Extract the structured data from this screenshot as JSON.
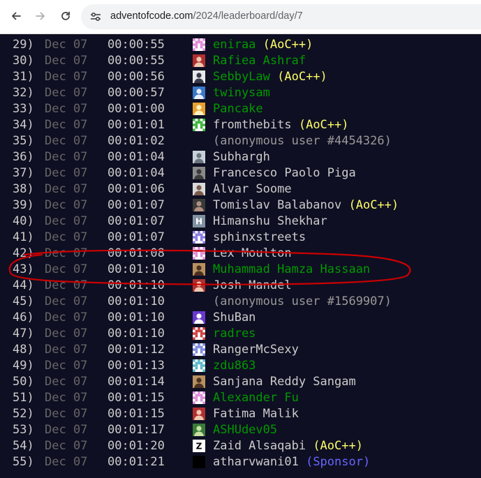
{
  "browser": {
    "url_host": "adventofcode.com",
    "url_path": "/2024/leaderboard/day/7",
    "icons": [
      "back-arrow-icon",
      "forward-arrow-icon",
      "reload-icon",
      "site-settings-icon"
    ]
  },
  "colors": {
    "background": "#0f0f23",
    "text": "#cccccc",
    "date": "#666666",
    "link_green": "#009900",
    "aocpp": "#ffff66",
    "sponsor": "#6666ff",
    "annotation": "#cc0000"
  },
  "leaderboard": {
    "rows": [
      {
        "rank": "29)",
        "date": "Dec 07",
        "time": "00:00:55",
        "name": "eniraa",
        "badge": "(AoC++)",
        "style": "green",
        "avatar": "pink-pixel"
      },
      {
        "rank": "30)",
        "date": "Dec 07",
        "time": "00:00:55",
        "name": "Rafiea Ashraf",
        "badge": "",
        "style": "green",
        "avatar": "photo-red"
      },
      {
        "rank": "31)",
        "date": "Dec 07",
        "time": "00:00:56",
        "name": "SebbyLaw",
        "badge": "(AoC++)",
        "style": "green",
        "avatar": "anime"
      },
      {
        "rank": "32)",
        "date": "Dec 07",
        "time": "00:00:57",
        "name": "twinysam",
        "badge": "",
        "style": "green",
        "avatar": "blue-figure"
      },
      {
        "rank": "33)",
        "date": "Dec 07",
        "time": "00:01:00",
        "name": "Pancake",
        "badge": "",
        "style": "green",
        "avatar": "pancake"
      },
      {
        "rank": "34)",
        "date": "Dec 07",
        "time": "00:01:01",
        "name": "fromthebits",
        "badge": "(AoC++)",
        "style": "normal",
        "avatar": "green-pixel"
      },
      {
        "rank": "35)",
        "date": "Dec 07",
        "time": "00:01:02",
        "name": "(anonymous user #4454326)",
        "badge": "",
        "style": "anon",
        "avatar": "none"
      },
      {
        "rank": "36)",
        "date": "Dec 07",
        "time": "00:01:04",
        "name": "Subhargh",
        "badge": "",
        "style": "normal",
        "avatar": "default-person"
      },
      {
        "rank": "37)",
        "date": "Dec 07",
        "time": "00:01:04",
        "name": "Francesco Paolo Piga",
        "badge": "",
        "style": "normal",
        "avatar": "photo-gray"
      },
      {
        "rank": "38)",
        "date": "Dec 07",
        "time": "00:01:06",
        "name": "Alvar Soome",
        "badge": "",
        "style": "normal",
        "avatar": "photo-light"
      },
      {
        "rank": "39)",
        "date": "Dec 07",
        "time": "00:01:07",
        "name": "Tomislav Balabanov",
        "badge": "(AoC++)",
        "style": "normal",
        "avatar": "photo-dark"
      },
      {
        "rank": "40)",
        "date": "Dec 07",
        "time": "00:01:07",
        "name": "Himanshu Shekhar",
        "badge": "",
        "style": "normal",
        "avatar": "letter-h"
      },
      {
        "rank": "41)",
        "date": "Dec 07",
        "time": "00:01:07",
        "name": "sphinxstreets",
        "badge": "",
        "style": "normal",
        "avatar": "purple-pixel"
      },
      {
        "rank": "42)",
        "date": "Dec 07",
        "time": "00:01:08",
        "name": "Lex Moulton",
        "badge": "",
        "style": "normal",
        "avatar": "pink-pixel"
      },
      {
        "rank": "43)",
        "date": "Dec 07",
        "time": "00:01:10",
        "name": "Muhammad Hamza Hassaan",
        "badge": "",
        "style": "green",
        "avatar": "photo-warm"
      },
      {
        "rank": "44)",
        "date": "Dec 07",
        "time": "00:01:10",
        "name": "Josh Mandel",
        "badge": "",
        "style": "normal",
        "avatar": "photo-red"
      },
      {
        "rank": "45)",
        "date": "Dec 07",
        "time": "00:01:10",
        "name": "(anonymous user #1569907)",
        "badge": "",
        "style": "anon",
        "avatar": "none"
      },
      {
        "rank": "46)",
        "date": "Dec 07",
        "time": "00:01:10",
        "name": "ShuBan",
        "badge": "",
        "style": "normal",
        "avatar": "purple-unicorn"
      },
      {
        "rank": "47)",
        "date": "Dec 07",
        "time": "00:01:10",
        "name": "radres",
        "badge": "",
        "style": "green",
        "avatar": "red-pixel"
      },
      {
        "rank": "48)",
        "date": "Dec 07",
        "time": "00:01:12",
        "name": "RangerMcSexy",
        "badge": "",
        "style": "normal",
        "avatar": "blue-pixel"
      },
      {
        "rank": "49)",
        "date": "Dec 07",
        "time": "00:01:13",
        "name": "zdu863",
        "badge": "",
        "style": "green",
        "avatar": "teal-pixel"
      },
      {
        "rank": "50)",
        "date": "Dec 07",
        "time": "00:01:14",
        "name": "Sanjana Reddy Sangam",
        "badge": "",
        "style": "normal",
        "avatar": "photo-warm"
      },
      {
        "rank": "51)",
        "date": "Dec 07",
        "time": "00:01:15",
        "name": "Alexander Fu",
        "badge": "",
        "style": "green",
        "avatar": "pink-pixel"
      },
      {
        "rank": "52)",
        "date": "Dec 07",
        "time": "00:01:15",
        "name": "Fatima Malik",
        "badge": "",
        "style": "normal",
        "avatar": "photo-red"
      },
      {
        "rank": "53)",
        "date": "Dec 07",
        "time": "00:01:17",
        "name": "ASHUdev05",
        "badge": "",
        "style": "green",
        "avatar": "photo-green"
      },
      {
        "rank": "54)",
        "date": "Dec 07",
        "time": "00:01:20",
        "name": "Zaid Alsaqabi",
        "badge": "(AoC++)",
        "style": "normal",
        "avatar": "letter-z"
      },
      {
        "rank": "55)",
        "date": "Dec 07",
        "time": "00:01:21",
        "name": "atharvwani01",
        "badge": "(Sponsor)",
        "style": "normal",
        "avatar": "black"
      }
    ]
  }
}
